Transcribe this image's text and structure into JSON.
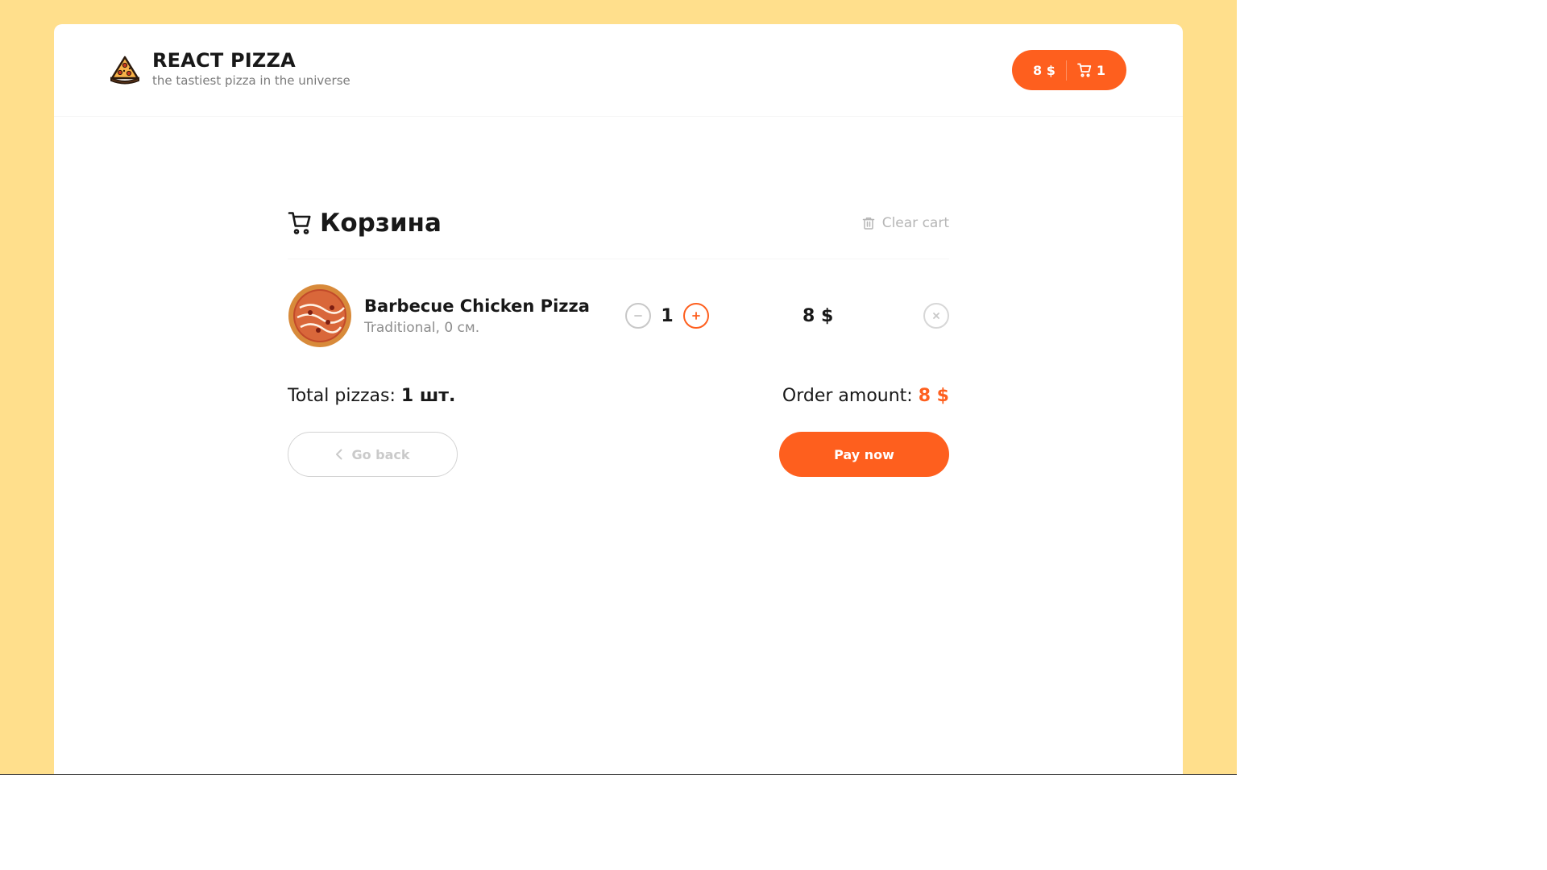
{
  "header": {
    "logo_title": "REACT PIZZA",
    "logo_subtitle": "the tastiest pizza in the universe",
    "cart_total": "8 $",
    "cart_count": "1"
  },
  "cart": {
    "title": "Корзина",
    "clear_label": "Clear cart",
    "items": [
      {
        "name": "Barbecue Chicken Pizza",
        "description": "Traditional, 0 см.",
        "quantity": "1",
        "price": "8 $"
      }
    ],
    "total_label": "Total pizzas: ",
    "total_value": "1 шт.",
    "amount_label": "Order amount: ",
    "amount_value": "8 $",
    "back_label": "Go back",
    "pay_label": "Pay now"
  },
  "colors": {
    "accent": "#fe5f1e",
    "background": "#ffdf8c"
  }
}
